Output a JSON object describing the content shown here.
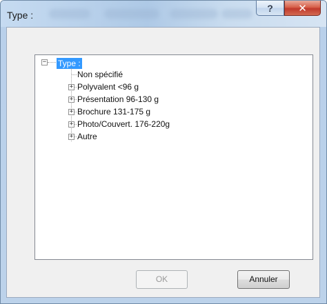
{
  "window": {
    "title": "Type :",
    "help_label": "?",
    "close_label": "✕"
  },
  "tree": {
    "root": {
      "label": "Type :",
      "expander": "−",
      "selected": true
    },
    "items": [
      {
        "label": "Non spécifié",
        "has_children": false
      },
      {
        "label": "Polyvalent <96 g",
        "has_children": true,
        "expander": "+"
      },
      {
        "label": "Présentation 96-130 g",
        "has_children": true,
        "expander": "+"
      },
      {
        "label": "Brochure 131-175 g",
        "has_children": true,
        "expander": "+"
      },
      {
        "label": "Photo/Couvert. 176-220g",
        "has_children": true,
        "expander": "+"
      },
      {
        "label": "Autre",
        "has_children": true,
        "expander": "+"
      }
    ]
  },
  "buttons": {
    "ok_label": "OK",
    "ok_enabled": false,
    "cancel_label": "Annuler"
  },
  "colors": {
    "selection": "#3399ff",
    "close_button": "#c0392b"
  }
}
